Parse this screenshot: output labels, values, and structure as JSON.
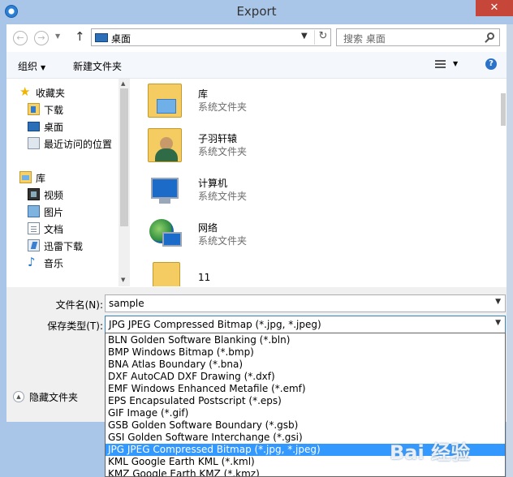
{
  "window": {
    "title": "Export",
    "close_label": "✕"
  },
  "nav": {
    "address": "桌面",
    "search_placeholder": "搜索 桌面"
  },
  "toolbar": {
    "organize": "组织",
    "new_folder": "新建文件夹"
  },
  "sidebar": {
    "items": [
      {
        "label": "收藏夹",
        "icon": "star-icon"
      },
      {
        "label": "下载",
        "icon": "downloads-folder-icon"
      },
      {
        "label": "桌面",
        "icon": "desktop-icon"
      },
      {
        "label": "最近访问的位置",
        "icon": "recent-places-icon"
      },
      {
        "label": "库",
        "icon": "library-icon"
      },
      {
        "label": "视频",
        "icon": "videos-icon"
      },
      {
        "label": "图片",
        "icon": "pictures-icon"
      },
      {
        "label": "文档",
        "icon": "documents-icon"
      },
      {
        "label": "迅雷下载",
        "icon": "thunder-download-icon"
      },
      {
        "label": "音乐",
        "icon": "music-icon"
      }
    ]
  },
  "content": {
    "items": [
      {
        "name": "库",
        "desc": "系统文件夹",
        "icon": "library-folder-icon"
      },
      {
        "name": "子羽轩辕",
        "desc": "系统文件夹",
        "icon": "user-folder-icon"
      },
      {
        "name": "计算机",
        "desc": "系统文件夹",
        "icon": "computer-icon"
      },
      {
        "name": "网络",
        "desc": "系统文件夹",
        "icon": "network-icon"
      },
      {
        "name": "11",
        "desc": "",
        "icon": "folder-icon"
      }
    ]
  },
  "form": {
    "filename_label": "文件名(N):",
    "filename_value": "sample",
    "filetype_label": "保存类型(T):",
    "filetype_value": "JPG JPEG Compressed Bitmap (*.jpg, *.jpeg)",
    "hide_folders": "隐藏文件夹"
  },
  "dropdown": {
    "selected_index": 9,
    "options": [
      "BLN Golden Software Blanking (*.bln)",
      "BMP Windows Bitmap (*.bmp)",
      "BNA Atlas Boundary (*.bna)",
      "DXF AutoCAD DXF Drawing (*.dxf)",
      "EMF Windows Enhanced Metafile (*.emf)",
      "EPS Encapsulated Postscript (*.eps)",
      "GIF Image (*.gif)",
      "GSB Golden Software Boundary (*.gsb)",
      "GSI Golden Software Interchange (*.gsi)",
      "JPG JPEG Compressed Bitmap (*.jpg, *.jpeg)",
      "KML Google Earth KML (*.kml)",
      "KMZ Google Earth KMZ (*.kmz)"
    ]
  },
  "watermark": "Bai 经验",
  "colors": {
    "selection": "#3399ff",
    "titlebar": "#a9c5e8",
    "close": "#c7463a"
  }
}
